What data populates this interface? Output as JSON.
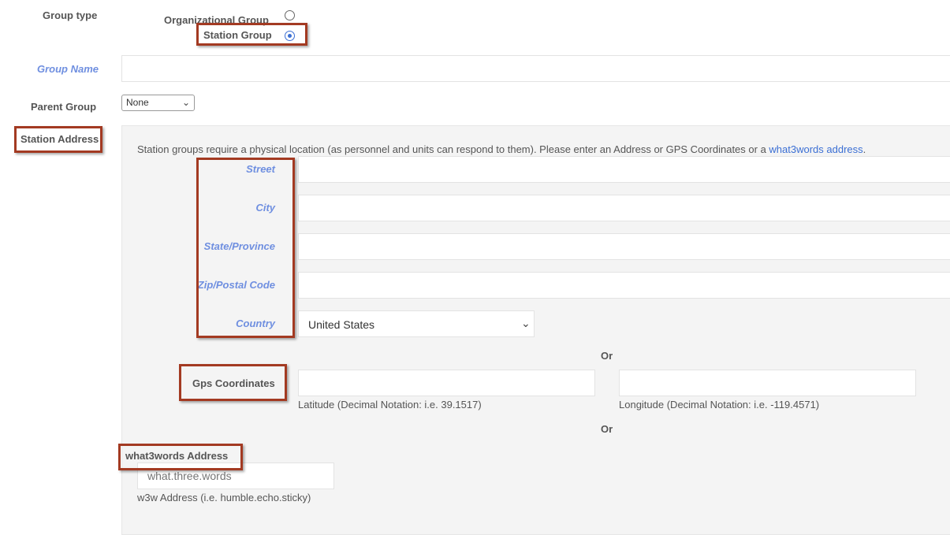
{
  "group_type": {
    "label": "Group type",
    "options": [
      {
        "label": "Organizational Group",
        "checked": false
      },
      {
        "label": "Station Group",
        "checked": true
      }
    ]
  },
  "group_name": {
    "label": "Group Name",
    "value": ""
  },
  "parent_group": {
    "label": "Parent Group",
    "selected": "None"
  },
  "station_address": {
    "label": "Station Address",
    "intro_text": "Station groups require a physical location (as personnel and units can respond to them). Please enter an Address or GPS Coordinates or a",
    "intro_link": "what3words address",
    "intro_end": ".",
    "fields": {
      "street": {
        "label": "Street",
        "value": ""
      },
      "city": {
        "label": "City",
        "value": ""
      },
      "state": {
        "label": "State/Province",
        "value": ""
      },
      "zip": {
        "label": "Zip/Postal Code",
        "value": ""
      },
      "country": {
        "label": "Country",
        "selected": "United States"
      }
    },
    "or_label": "Or",
    "gps": {
      "label": "Gps Coordinates",
      "latitude_value": "",
      "latitude_help": "Latitude (Decimal Notation: i.e. 39.1517)",
      "longitude_value": "",
      "longitude_help": "Longitude (Decimal Notation: i.e. -119.4571)"
    },
    "w3w": {
      "label": "what3words Address",
      "placeholder": "what.three.words",
      "help": "w3w Address (i.e. humble.echo.sticky)"
    }
  },
  "colors": {
    "highlight_box": "#a33a22",
    "label_blue": "#6f8fe0",
    "link_blue": "#3b6fd4"
  }
}
